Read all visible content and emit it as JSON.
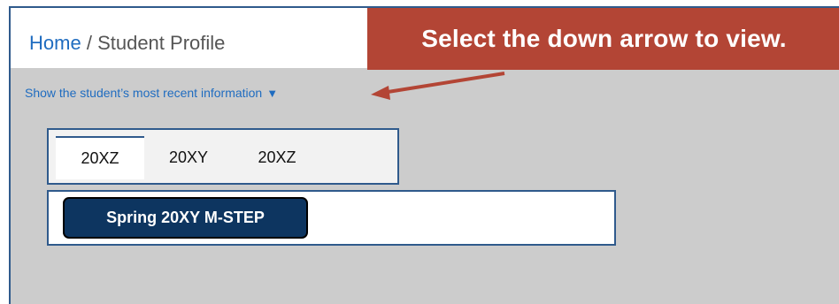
{
  "breadcrumb": {
    "home": "Home",
    "separator": "/",
    "current": "Student Profile"
  },
  "callout": {
    "text": "Select the down arrow to view."
  },
  "recent_info": {
    "label": "Show the student’s most recent information",
    "arrow": "▼"
  },
  "tabs": [
    {
      "label": "20XZ",
      "active": true
    },
    {
      "label": "20XY",
      "active": false
    },
    {
      "label": "20XZ",
      "active": false
    }
  ],
  "assessment": {
    "button_label": "Spring 20XY M-STEP"
  },
  "colors": {
    "link": "#1f6cc0",
    "callout_bg": "#b34535",
    "border": "#2f5a8c",
    "button_bg": "#0d3560",
    "background": "#cccccc"
  }
}
